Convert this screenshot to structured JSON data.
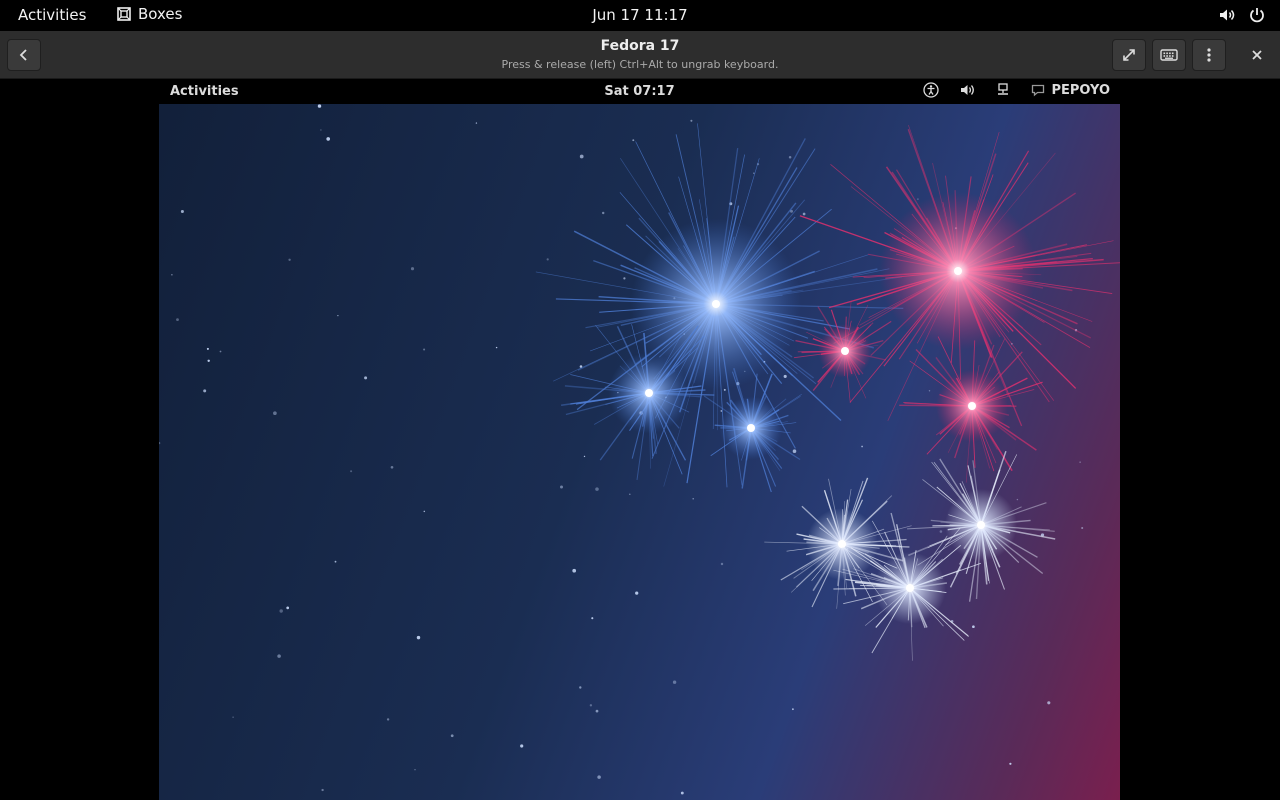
{
  "host": {
    "activities": "Activities",
    "app_name": "Boxes",
    "clock": "Jun 17  11:17"
  },
  "header": {
    "title": "Fedora 17",
    "subtitle": "Press & release (left) Ctrl+Alt to ungrab keyboard."
  },
  "guest": {
    "activities": "Activities",
    "clock": "Sat 07:17",
    "user": "PEPOYO"
  },
  "colors": {
    "host_bar": "#000000",
    "header": "#2d2d2d",
    "firework_blue": "#4f7fd8",
    "firework_pink": "#e0306e",
    "firework_white": "#e8eefc"
  },
  "icons": {
    "host_app": "boxes-icon",
    "host_volume": "volume-icon",
    "host_power": "power-icon",
    "back": "back-arrow-icon",
    "fullscreen": "fullscreen-icon",
    "keyboard": "keyboard-icon",
    "menu": "menu-dots-icon",
    "close": "close-icon",
    "guest_accessibility": "accessibility-icon",
    "guest_volume": "volume-icon",
    "guest_network": "network-icon",
    "guest_chat": "chat-icon"
  }
}
